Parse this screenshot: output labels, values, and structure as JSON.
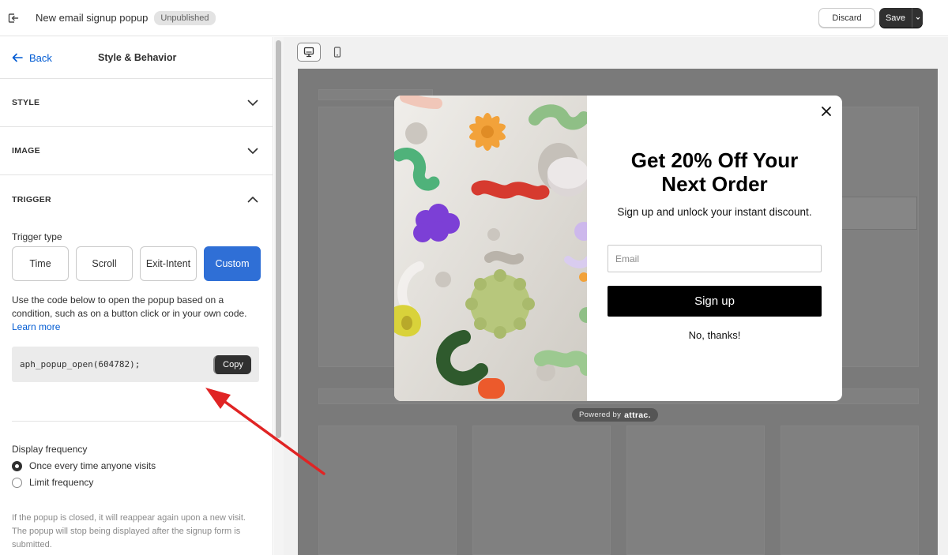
{
  "topbar": {
    "title": "New email signup popup",
    "status_badge": "Unpublished",
    "discard_label": "Discard",
    "save_label": "Save"
  },
  "sidebar": {
    "back_label": "Back",
    "title": "Style & Behavior",
    "sections": {
      "style": "STYLE",
      "image": "IMAGE",
      "trigger": "TRIGGER"
    },
    "trigger": {
      "type_label": "Trigger type",
      "options": [
        "Time",
        "Scroll",
        "Exit-Intent",
        "Custom"
      ],
      "selected": "Custom",
      "description": "Use the code below to open the popup based on a condition, such as on a button click or in your own code.",
      "learn_more": "Learn more",
      "code": "aph_popup_open(604782);",
      "copy_label": "Copy"
    },
    "frequency": {
      "label": "Display frequency",
      "options": [
        "Once every time anyone visits",
        "Limit frequency"
      ],
      "selected": "Once every time anyone visits",
      "help": "If the popup is closed, it will reappear again upon a new visit. The popup will stop being displayed after the signup form is submitted."
    }
  },
  "preview": {
    "device_selected": "desktop",
    "popup": {
      "headline": "Get 20% Off Your Next Order",
      "subhead": "Sign up and unlock your instant discount.",
      "email_placeholder": "Email",
      "signup_label": "Sign up",
      "decline_label": "No, thanks!"
    },
    "powered_by": "Powered by",
    "powered_brand": "attrac."
  },
  "colors": {
    "primary_blue": "#2f6fd6",
    "link_blue": "#005bd3",
    "dark_button": "#303030",
    "overlay": "#7a7a7a",
    "annotation_arrow": "#e02424"
  }
}
